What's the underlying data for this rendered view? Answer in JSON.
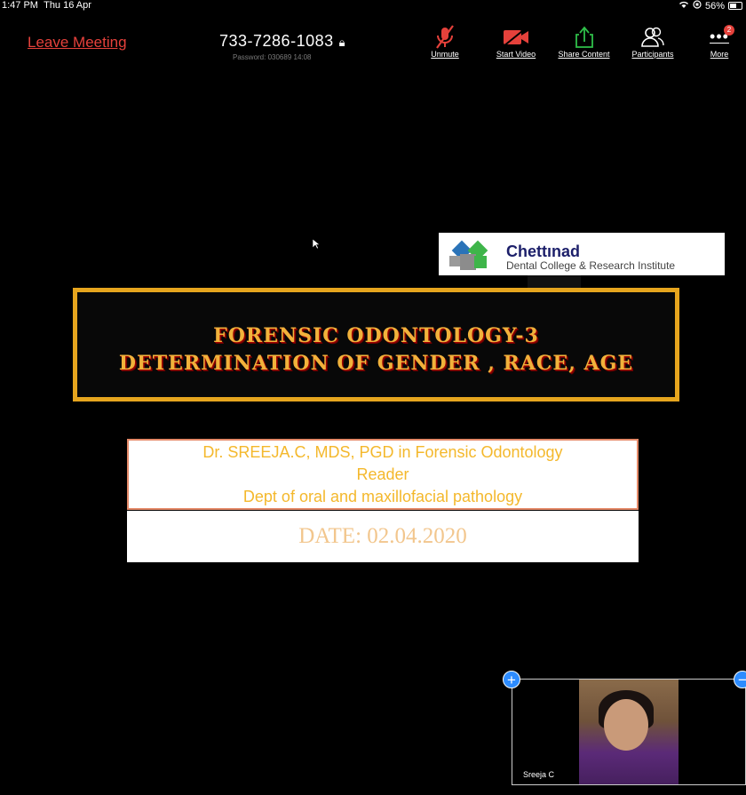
{
  "status": {
    "time": "1:47 PM",
    "date": "Thu 16 Apr",
    "battery": "56%"
  },
  "toolbar": {
    "leave": "Leave Meeting",
    "meeting_id": "733-7286-1083",
    "password": "Password: 030689   14:08",
    "unmute": "Unmute",
    "start_video": "Start Video",
    "share": "Share Content",
    "participants": "Participants",
    "more": "More",
    "more_badge": "2"
  },
  "slide": {
    "logo_name": "Chettınad",
    "logo_sub": "Dental College & Research Institute",
    "title1": "FORENSIC ODONTOLOGY-3",
    "title2": "DETERMINATION OF GENDER , RACE, AGE",
    "author_line1": "Dr. SREEJA.C, MDS, PGD in Forensic Odontology",
    "author_line2": "Reader",
    "author_line3": "Dept of oral and maxillofacial pathology",
    "date": "DATE: 02.04.2020"
  },
  "video": {
    "name": "Sreeja C",
    "plus": "+",
    "minus": "−"
  },
  "colors": {
    "accent_red": "#e5413b",
    "title_gold": "#f1b23b",
    "zoom_blue": "#2d8cff"
  }
}
